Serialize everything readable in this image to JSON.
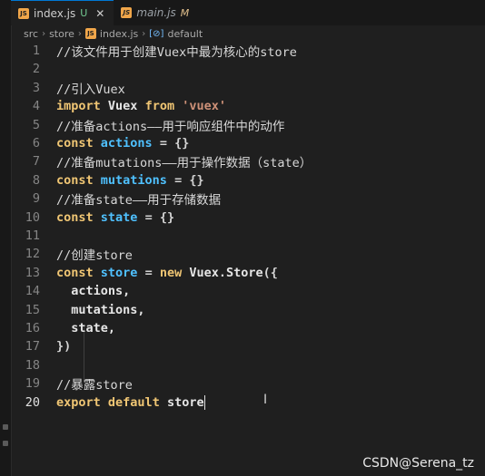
{
  "tabs": [
    {
      "filename": "index.js",
      "status": "U"
    },
    {
      "filename": "main.js",
      "status": "M"
    }
  ],
  "breadcrumb": [
    "src",
    "store",
    "index.js",
    "default"
  ],
  "current_line": "20",
  "lines": [
    {
      "n": "1"
    },
    {
      "n": "2"
    },
    {
      "n": "3"
    },
    {
      "n": "4"
    },
    {
      "n": "5"
    },
    {
      "n": "6"
    },
    {
      "n": "7"
    },
    {
      "n": "8"
    },
    {
      "n": "9"
    },
    {
      "n": "10"
    },
    {
      "n": "11"
    },
    {
      "n": "12"
    },
    {
      "n": "13"
    },
    {
      "n": "14"
    },
    {
      "n": "15"
    },
    {
      "n": "16"
    },
    {
      "n": "17"
    },
    {
      "n": "18"
    },
    {
      "n": "19"
    },
    {
      "n": "20"
    }
  ],
  "code": {
    "l1": "//该文件用于创建Vuex中最为核心的store",
    "l3": "//引入Vuex",
    "l4": {
      "kw1": "import",
      "id": "Vuex",
      "kw2": "from",
      "str": "'vuex'"
    },
    "l5": "//准备actions——用于响应组件中的动作",
    "l6": {
      "kw": "const",
      "id": "actions",
      "rest": "= {}"
    },
    "l7": "//准备mutations——用于操作数据（state）",
    "l8": {
      "kw": "const",
      "id": "mutations",
      "rest": "= {}"
    },
    "l9": "//准备state——用于存储数据",
    "l10": {
      "kw": "const",
      "id": "state",
      "rest": "= {}"
    },
    "l12": "//创建store",
    "l13": {
      "kw1": "const",
      "id1": "store",
      "op": "=",
      "kw2": "new",
      "cls": "Vuex",
      "dot": ".",
      "method": "Store",
      "rest": "({"
    },
    "l14": "actions,",
    "l15": "mutations,",
    "l16": "state,",
    "l17": "})",
    "l19": "//暴露store",
    "l20": {
      "kw1": "export",
      "kw2": "default",
      "id": "store"
    }
  },
  "watermark": "CSDN@Serena_tz",
  "colors": {
    "accent": "#0078d4",
    "keyword": "#f0c674",
    "identifier": "#4fc1ff",
    "string": "#ce9178"
  }
}
